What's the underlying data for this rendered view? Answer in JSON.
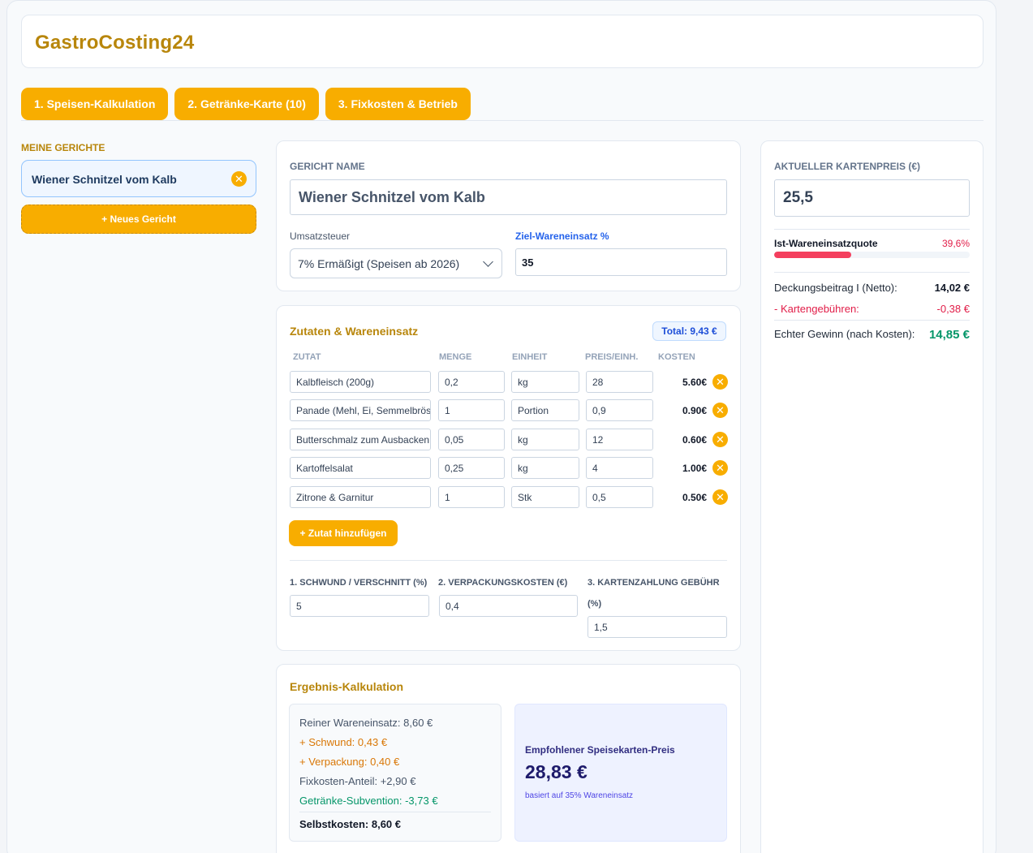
{
  "app": {
    "brand": "GastroCosting24"
  },
  "tabs": [
    {
      "label": "1. Speisen-Kalkulation"
    },
    {
      "label": "2. Getränke-Karte (10)"
    },
    {
      "label": "3. Fixkosten & Betrieb"
    }
  ],
  "sidebar": {
    "title": "MEINE GERICHTE",
    "dishes": [
      {
        "label": "Wiener Schnitzel vom Kalb"
      }
    ],
    "new_dish_label": "+ Neues Gericht"
  },
  "dish_card": {
    "name_label": "GERICHT NAME",
    "name_value": "Wiener Schnitzel vom Kalb",
    "vat_label": "Umsatzsteuer",
    "vat_value": "7% Ermäßigt (Speisen ab 2026)",
    "target_label": "Ziel-Wareneinsatz %",
    "target_value": "35"
  },
  "ingredients": {
    "title": "Zutaten & Wareneinsatz",
    "total_badge": "Total: 9,43 €",
    "columns": [
      "ZUTAT",
      "MENGE",
      "EINHEIT",
      "PREIS/EINH.",
      "KOSTEN"
    ],
    "rows": [
      {
        "name": "Kalbfleisch (200g)",
        "qty": "0,2",
        "unit": "kg",
        "price": "28",
        "cost": "5.60€"
      },
      {
        "name": "Panade (Mehl, Ei, Semmelbrösel)",
        "qty": "1",
        "unit": "Portion",
        "price": "0,9",
        "cost": "0.90€"
      },
      {
        "name": "Butterschmalz zum Ausbacken",
        "qty": "0,05",
        "unit": "kg",
        "price": "12",
        "cost": "0.60€"
      },
      {
        "name": "Kartoffelsalat",
        "qty": "0,25",
        "unit": "kg",
        "price": "4",
        "cost": "1.00€"
      },
      {
        "name": "Zitrone & Garnitur",
        "qty": "1",
        "unit": "Stk",
        "price": "0,5",
        "cost": "0.50€"
      }
    ],
    "add_label": "+ Zutat hinzufügen",
    "shrink_label": "1. SCHWUND / VERSCHNITT (%)",
    "shrink_value": "5",
    "packaging_label": "2. VERPACKUNGSKOSTEN (€)",
    "packaging_value": "0,4",
    "card_fee_label_1": "3. KARTENZAHLUNG GEBÜHR",
    "card_fee_label_2": "(%)",
    "card_fee_value": "1,5"
  },
  "result": {
    "title": "Ergebnis-Kalkulation",
    "lines": [
      {
        "text": "Reiner Wareneinsatz: 8,60 €",
        "color": "#475569"
      },
      {
        "text": "+ Schwund: 0,43 €",
        "color": "#d97706"
      },
      {
        "text": "+ Verpackung: 0,40 €",
        "color": "#d97706"
      },
      {
        "text": "Fixkosten-Anteil: +2,90 €",
        "color": "#475569"
      },
      {
        "text": "Getränke-Subvention: -3,73 €",
        "color": "#059669"
      }
    ],
    "self_cost": "Selbstkosten: 8,60 €",
    "rec_title": "Empfohlener Speisekarten-Preis",
    "rec_price": "28,83 €",
    "rec_sub": "basiert auf 35% Wareneinsatz"
  },
  "summary": {
    "price_label": "AKTUELLER KARTENPREIS (€)",
    "price_value": "25,5",
    "quota_label": "Ist-Wareneinsatzquote",
    "quota_value": "39,6%",
    "quota_fraction": 0.396,
    "db_label": "Deckungsbeitrag I (Netto):",
    "db_value": "14,02 €",
    "fees_label": "- Kartengebühren:",
    "fees_value": "-0,38 €",
    "profit_label": "Echter Gewinn (nach Kosten):",
    "profit_value": "14,85 €"
  },
  "colors": {
    "accent": "#f8ad00",
    "brand": "#b8860b",
    "negative": "#e11d48",
    "positive": "#059669"
  }
}
